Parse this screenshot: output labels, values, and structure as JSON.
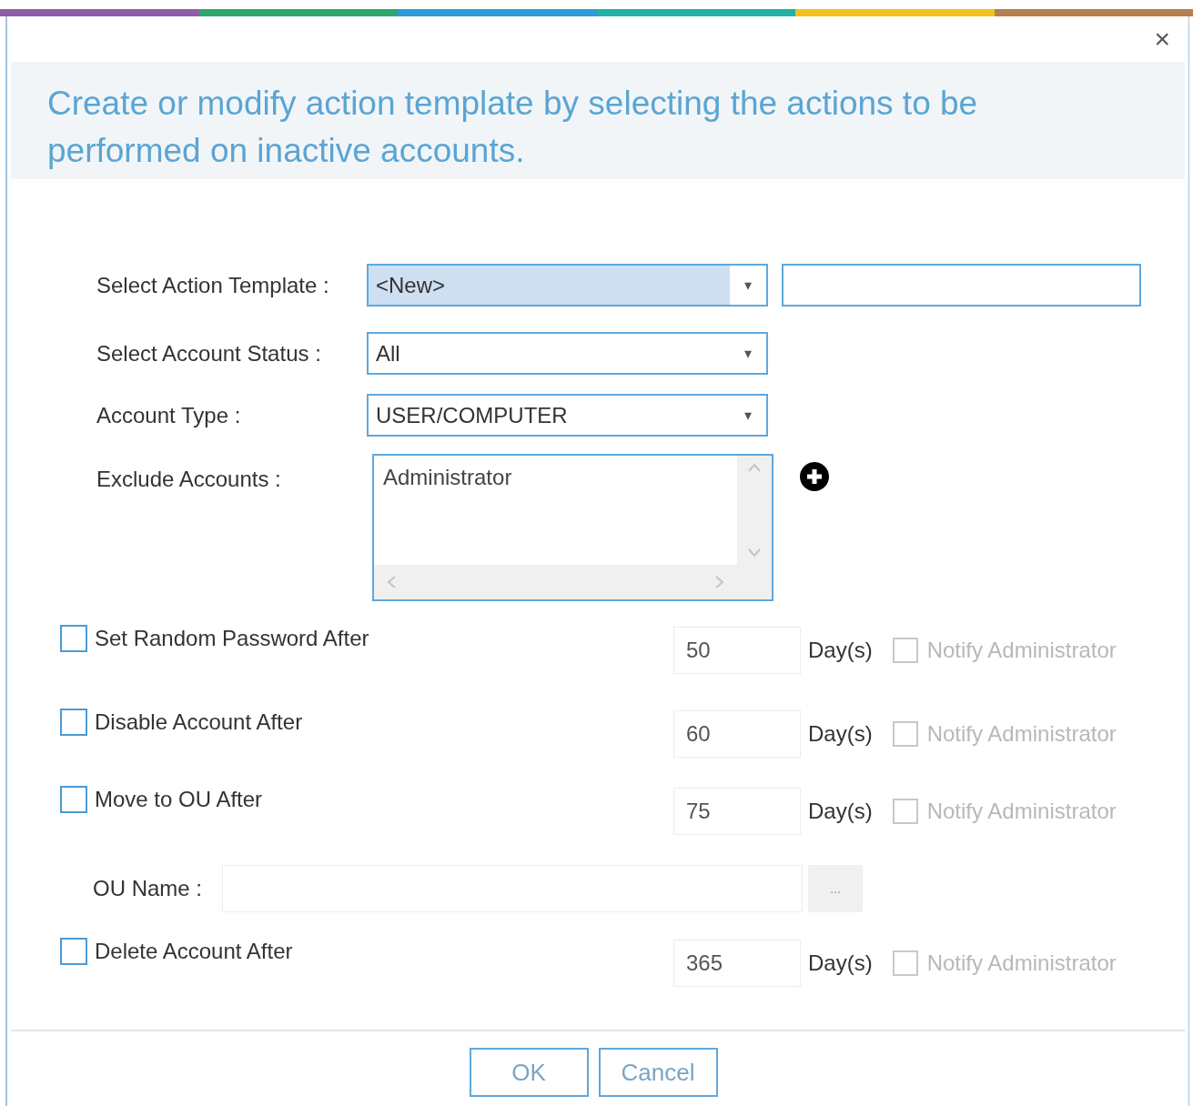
{
  "window": {
    "close_glyph": "×"
  },
  "heading": "Create or modify action template by selecting the actions to be performed on inactive accounts.",
  "fields": [
    {
      "kind": "combo",
      "label": "Select Action Template :",
      "value": "<New>",
      "highlighted": true,
      "caret": "▾",
      "name_field": true
    },
    {
      "kind": "combo",
      "label": "Select Account Status :",
      "value": "All",
      "highlighted": false,
      "caret": "▾",
      "name_field": false
    },
    {
      "kind": "combo",
      "label": "Account Type :",
      "value": "USER/COMPUTER",
      "highlighted": false,
      "caret": "▾",
      "name_field": false
    },
    {
      "kind": "list",
      "label": "Exclude Accounts :",
      "items": [
        "Administrator"
      ]
    }
  ],
  "actions": [
    {
      "kind": "action",
      "label": "Set Random Password After",
      "checked": false,
      "days": "50",
      "unit": "Day(s)",
      "notify_label": "Notify Administrator",
      "notify_checked": false,
      "notify_disabled": true
    },
    {
      "kind": "action",
      "label": "Disable Account After",
      "checked": false,
      "days": "60",
      "unit": "Day(s)",
      "notify_label": "Notify Administrator",
      "notify_checked": false,
      "notify_disabled": true
    },
    {
      "kind": "action",
      "label": "Move to OU After",
      "checked": false,
      "days": "75",
      "unit": "Day(s)",
      "notify_label": "Notify Administrator",
      "notify_checked": false,
      "notify_disabled": true
    },
    {
      "kind": "ou",
      "label": "OU Name :",
      "button": "...",
      "disabled": true
    },
    {
      "kind": "action",
      "label": "Delete Account After",
      "checked": false,
      "days": "365",
      "unit": "Day(s)",
      "notify_label": "Notify Administrator",
      "notify_checked": false,
      "notify_disabled": true
    }
  ],
  "buttons": [
    "OK",
    "Cancel"
  ]
}
